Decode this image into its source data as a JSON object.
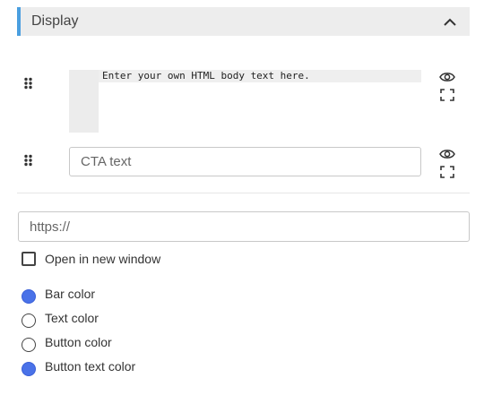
{
  "section": {
    "title": "Display"
  },
  "html_editor": {
    "code_text": "Enter your own HTML body text here."
  },
  "cta": {
    "placeholder": "CTA text"
  },
  "url": {
    "placeholder": "https://"
  },
  "open_new_window": {
    "label": "Open in new window",
    "checked": false
  },
  "colors": [
    {
      "label": "Bar color",
      "color": "#4a72e8"
    },
    {
      "label": "Text color",
      "color": "#ffffff"
    },
    {
      "label": "Button color",
      "color": "#ffffff"
    },
    {
      "label": "Button text color",
      "color": "#4a72e8"
    }
  ],
  "icons": {
    "collapse": "chevron-up-icon",
    "drag": "drag-handle-icon",
    "preview": "eye-icon",
    "fullscreen": "fullscreen-icon"
  }
}
